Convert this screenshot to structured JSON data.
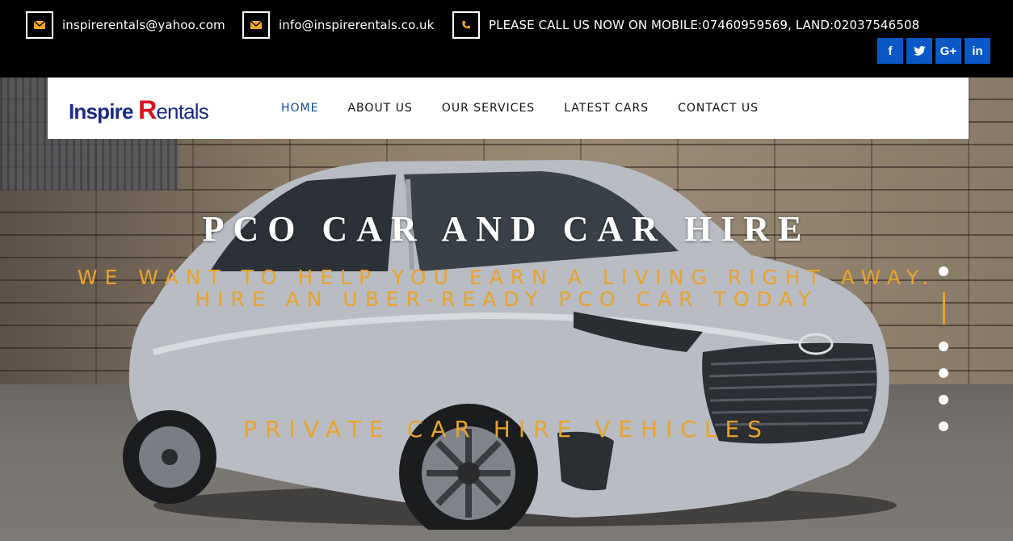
{
  "topbar": {
    "contacts": [
      {
        "icon": "envelope-icon",
        "text": "inspirerentals@yahoo.com"
      },
      {
        "icon": "envelope-icon",
        "text": "info@inspirerentals.co.uk"
      },
      {
        "icon": "phone-icon",
        "text": "PLEASE CALL US NOW ON MOBILE:07460959569, LAND:02037546508"
      }
    ],
    "social": [
      {
        "icon": "facebook-icon",
        "glyph": "f"
      },
      {
        "icon": "twitter-icon",
        "glyph": "t"
      },
      {
        "icon": "google-plus-icon",
        "glyph": "G+"
      },
      {
        "icon": "linkedin-icon",
        "glyph": "in"
      }
    ],
    "icon_color": "#f5a623",
    "social_color": "#0a58c8"
  },
  "nav": {
    "logo": {
      "part1": "Inspire ",
      "part2": "R",
      "part3": "entals"
    },
    "items": [
      "HOME",
      "ABOUT US",
      "OUR SERVICES",
      "LATEST CARS",
      "CONTACT US"
    ],
    "active_index": 0,
    "active_color": "#0a4a9a"
  },
  "hero": {
    "title": "PCO CAR AND CAR HIRE",
    "subtitle": "WE WANT TO HELP YOU EARN A LIVING RIGHT AWAY. HIRE AN UBER-READY PCO CAR TODAY",
    "tagline": "PRIVATE CAR HIRE VEHICLES",
    "accent_color": "#e9a32a",
    "slides_total": 5,
    "active_slide": 1
  }
}
